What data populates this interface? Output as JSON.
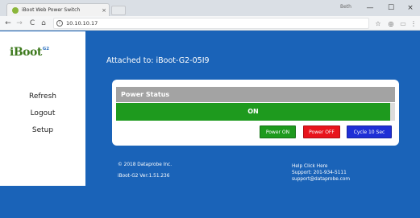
{
  "browser": {
    "tab_title": "iBoot Web Power Switch",
    "tab_close": "×",
    "user_label": "Beth",
    "minimize": "—",
    "maximize": "☐",
    "close": "×",
    "url": "10.10.10.17",
    "nav": {
      "back": "←",
      "forward": "→",
      "reload": "C",
      "home": "⌂"
    },
    "icons": {
      "info": "i",
      "star": "☆",
      "extension": "◎",
      "more_ext": "▭",
      "menu": "⋮"
    }
  },
  "sidebar": {
    "logo_main": "iBoot",
    "logo_sup": "G2",
    "items": [
      {
        "label": "Refresh"
      },
      {
        "label": "Logout"
      },
      {
        "label": "Setup"
      }
    ]
  },
  "main": {
    "attached": "Attached to: iBoot-G2-05I9",
    "panel": {
      "header": "Power Status",
      "status": "ON",
      "status_color": "#1e9a1e",
      "buttons": [
        {
          "label": "Power ON",
          "color": "#1e9a1e"
        },
        {
          "label": "Power OFF",
          "color": "#e8141c"
        },
        {
          "label": "Cycle 10 Sec",
          "color": "#1f2fd6"
        }
      ]
    }
  },
  "footer": {
    "copyright": "© 2018 Dataprobe Inc.",
    "version": "iBoot-G2 Ver:1.51.236",
    "help": "Help Click Here",
    "support": "Support: 201-934-5111",
    "email": "support@dataprobe.com"
  }
}
